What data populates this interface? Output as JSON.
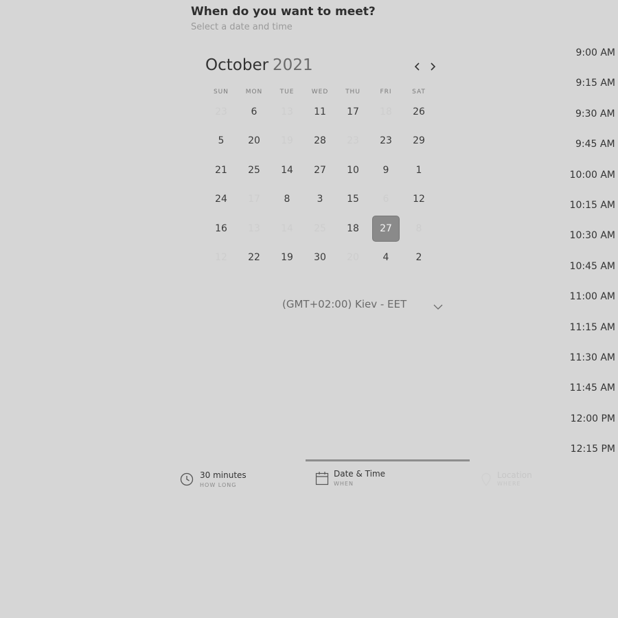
{
  "header": {
    "title": "When do you want to meet?",
    "subtitle": "Select a date and time"
  },
  "calendar": {
    "month": "October",
    "year": "2021",
    "weekdays": [
      "SUN",
      "MON",
      "TUE",
      "WED",
      "THU",
      "FRI",
      "SAT"
    ],
    "weeks": [
      [
        {
          "n": "23",
          "d": true
        },
        {
          "n": "6"
        },
        {
          "n": "13",
          "d": true
        },
        {
          "n": "11"
        },
        {
          "n": "17"
        },
        {
          "n": "18",
          "d": true
        },
        {
          "n": "26"
        }
      ],
      [
        {
          "n": "5"
        },
        {
          "n": "20"
        },
        {
          "n": "19",
          "d": true
        },
        {
          "n": "28"
        },
        {
          "n": "23",
          "d": true
        },
        {
          "n": "23"
        },
        {
          "n": "29"
        }
      ],
      [
        {
          "n": "21"
        },
        {
          "n": "25"
        },
        {
          "n": "14"
        },
        {
          "n": "27"
        },
        {
          "n": "10"
        },
        {
          "n": "9"
        },
        {
          "n": "1"
        }
      ],
      [
        {
          "n": "24"
        },
        {
          "n": "17",
          "d": true
        },
        {
          "n": "8"
        },
        {
          "n": "3"
        },
        {
          "n": "15"
        },
        {
          "n": "6",
          "d": true
        },
        {
          "n": "12"
        }
      ],
      [
        {
          "n": "16"
        },
        {
          "n": "13",
          "d": true
        },
        {
          "n": "14",
          "d": true
        },
        {
          "n": "25",
          "d": true
        },
        {
          "n": "18"
        },
        {
          "n": "27",
          "s": true
        },
        {
          "n": "8",
          "d": true
        }
      ],
      [
        {
          "n": "12",
          "d": true
        },
        {
          "n": "22"
        },
        {
          "n": "19"
        },
        {
          "n": "30"
        },
        {
          "n": "20",
          "d": true
        },
        {
          "n": "4"
        },
        {
          "n": "2"
        }
      ]
    ]
  },
  "timezone": {
    "label": "(GMT+02:00) Kiev - EET"
  },
  "time_slots": [
    "9:00 AM",
    "9:15 AM",
    "9:30 AM -",
    "9:45 AM -",
    "10:00 AM",
    "10:15 AM",
    "10:30 AM",
    "10:45 AM",
    "11:00 AM",
    "11:15 AM",
    "11:30 AM",
    "11:45 AM",
    "12:00 PM",
    "12:15 PM"
  ],
  "steps": [
    {
      "main": "30 minutes",
      "sub": "HOW LONG",
      "icon": "clock-icon"
    },
    {
      "main": "Date & Time",
      "sub": "WHEN",
      "icon": "calendar-icon"
    },
    {
      "main": "Location",
      "sub": "WHERE",
      "icon": "location-pin-icon"
    }
  ],
  "colors": {
    "background": "#d6d6d6",
    "selected_day": "#8a8a8a",
    "progress_line": "#8e8e8e"
  }
}
